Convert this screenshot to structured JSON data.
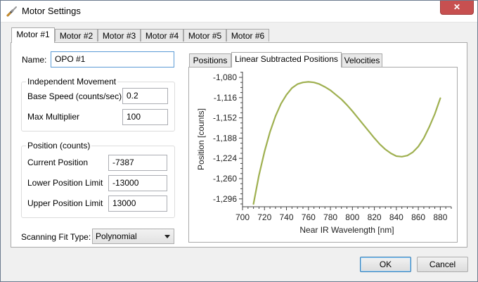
{
  "window": {
    "title": "Motor Settings",
    "close_glyph": "✕"
  },
  "motor_tabs": [
    "Motor #1",
    "Motor #2",
    "Motor #3",
    "Motor #4",
    "Motor #5",
    "Motor #6"
  ],
  "name": {
    "label": "Name:",
    "value": "OPO #1"
  },
  "independent": {
    "title": "Independent Movement",
    "base_speed_label": "Base Speed (counts/sec)",
    "base_speed_value": "0.2",
    "max_multiplier_label": "Max Multiplier",
    "max_multiplier_value": "100"
  },
  "position": {
    "title": "Position (counts)",
    "current_label": "Current Position",
    "current_value": "-7387",
    "lower_label": "Lower Position Limit",
    "lower_value": "-13000",
    "upper_label": "Upper Position Limit",
    "upper_value": "13000"
  },
  "fit": {
    "label": "Scanning Fit Type:",
    "value": "Polynomial"
  },
  "chart_tabs": [
    "Positions",
    "Linear Subtracted Positions",
    "Velocities"
  ],
  "buttons": {
    "ok": "OK",
    "cancel": "Cancel"
  },
  "chart_data": {
    "type": "line",
    "xlabel": "Near IR Wavelength [nm]",
    "ylabel": "Position [counts]",
    "xlim": [
      700,
      890
    ],
    "ylim": [
      -1310,
      -1070
    ],
    "x_ticks": [
      700,
      720,
      740,
      760,
      780,
      800,
      820,
      840,
      860,
      880
    ],
    "x_tick_labels": [
      "700",
      "720",
      "740",
      "760",
      "780",
      "800",
      "820",
      "840",
      "860",
      "880"
    ],
    "y_ticks": [
      -1080,
      -1116,
      -1152,
      -1188,
      -1224,
      -1260,
      -1296
    ],
    "y_tick_labels": [
      "-1,080",
      "-1,116",
      "-1,152",
      "-1,188",
      "-1,224",
      "-1,260",
      "-1,296"
    ],
    "line_color": "#9fb050",
    "series": [
      {
        "x": [
          710,
          715,
          720,
          725,
          730,
          735,
          740,
          745,
          750,
          755,
          760,
          765,
          770,
          775,
          780,
          785,
          790,
          795,
          800,
          805,
          810,
          815,
          820,
          825,
          830,
          835,
          840,
          845,
          850,
          855,
          860,
          865,
          870,
          875,
          880
        ],
        "y": [
          -1305,
          -1254,
          -1212,
          -1177,
          -1149,
          -1127,
          -1111,
          -1099,
          -1092,
          -1089,
          -1088,
          -1089,
          -1092,
          -1097,
          -1103,
          -1111,
          -1119,
          -1129,
          -1140,
          -1152,
          -1164,
          -1176,
          -1188,
          -1199,
          -1208,
          -1215,
          -1220,
          -1221,
          -1219,
          -1213,
          -1203,
          -1188,
          -1168,
          -1145,
          -1117
        ]
      }
    ]
  }
}
